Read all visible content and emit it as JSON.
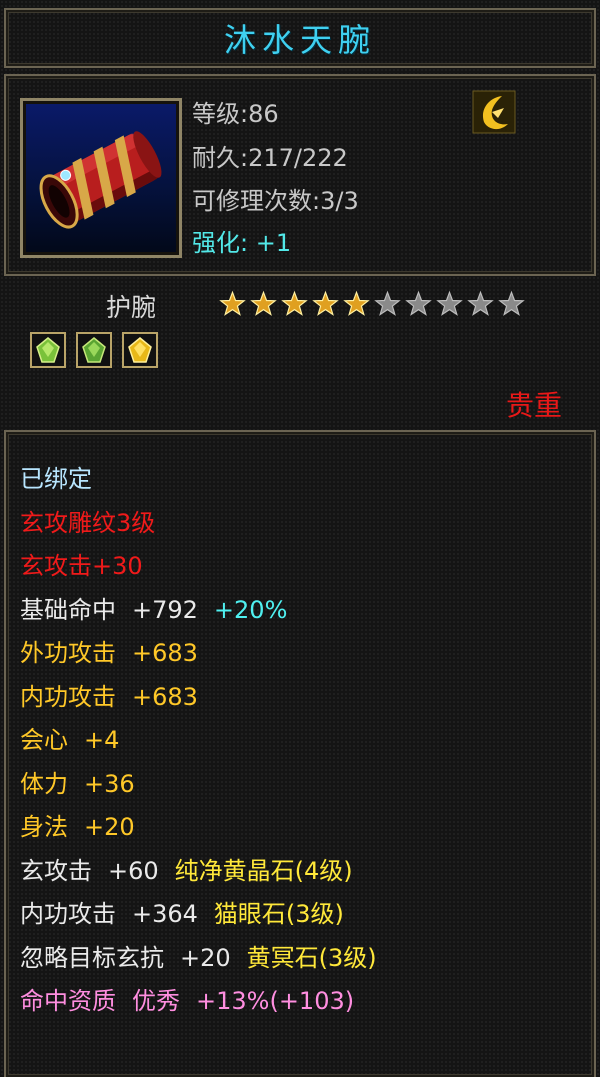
{
  "item": {
    "name": "沐水天腕",
    "level_text": "等级:86",
    "durability_text": "耐久:217/222",
    "repair_text": "可修理次数:3/3",
    "enhance_label": "强化:",
    "enhance_value": "+1",
    "type": "护腕",
    "stars_filled": 5,
    "stars_total": 10,
    "rarity": "贵重",
    "icon": "red-bracer-icon",
    "flag_icon": "gold-crescent-icon",
    "gems": [
      "green-gem-icon",
      "green-gem-icon",
      "yellow-gem-icon"
    ]
  },
  "attributes": {
    "bound": "已绑定",
    "engrave": "玄攻雕纹3级",
    "xuan_attack": "玄攻击+30",
    "hit_label": "基础命中",
    "hit_value": "+792",
    "hit_bonus": "+20%",
    "ext_label": "外功攻击",
    "ext_value": "+683",
    "int_label": "内功攻击",
    "int_value": "+683",
    "crit_label": "会心",
    "crit_value": "+4",
    "vit_label": "体力",
    "vit_value": "+36",
    "agi_label": "身法",
    "agi_value": "+20",
    "gem1_stat": "玄攻击",
    "gem1_value": "+60",
    "gem1_name": "纯净黄晶石(4级)",
    "gem2_stat": "内功攻击",
    "gem2_value": "+364",
    "gem2_name": "猫眼石(3级)",
    "gem3_stat": "忽略目标玄抗",
    "gem3_value": "+20",
    "gem3_name": "黄冥石(3级)",
    "apt_label": "命中资质",
    "apt_grade": "优秀",
    "apt_value": "+13%(+103)"
  },
  "colors": {
    "title": "#3fd0f0",
    "rarity": "#e81818",
    "gold_text": "#ffc828",
    "pink_text": "#ff8ee0",
    "star_filled": "#e0a020",
    "star_empty": "#8a8a8a"
  }
}
